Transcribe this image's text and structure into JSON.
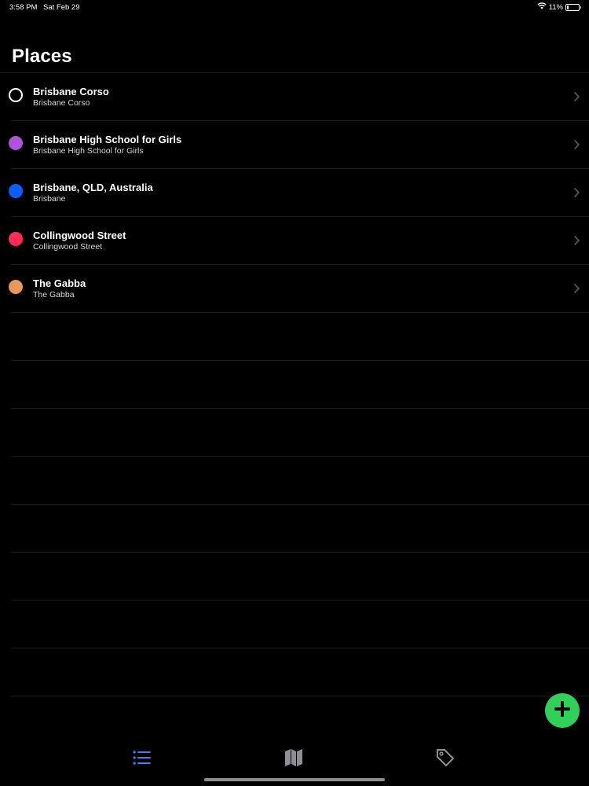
{
  "status_bar": {
    "time": "3:58 PM",
    "date": "Sat Feb 29",
    "battery_percent_label": "11%",
    "battery_level": 0.11,
    "icons": [
      "wifi-icon",
      "battery-icon"
    ]
  },
  "page": {
    "title": "Places"
  },
  "places": [
    {
      "title": "Brisbane Corso",
      "subtitle": "Brisbane Corso",
      "color": "#ffffff",
      "marker": "hollow"
    },
    {
      "title": "Brisbane High School for Girls",
      "subtitle": "Brisbane High School for Girls",
      "color": "#af52de",
      "marker": "filled"
    },
    {
      "title": "Brisbane, QLD, Australia",
      "subtitle": "Brisbane",
      "color": "#0a60ff",
      "marker": "filled"
    },
    {
      "title": "Collingwood Street",
      "subtitle": "Collingwood Street",
      "color": "#ff2d55",
      "marker": "filled"
    },
    {
      "title": "The Gabba",
      "subtitle": "The Gabba",
      "color": "#e8965a",
      "marker": "filled"
    }
  ],
  "empty_row_count": 8,
  "fab": {
    "icon": "plus-icon",
    "color": "#30d158"
  },
  "tab_bar": {
    "tabs": [
      {
        "name": "list",
        "icon": "list-icon",
        "selected": true
      },
      {
        "name": "map",
        "icon": "map-icon",
        "selected": false
      },
      {
        "name": "tags",
        "icon": "tag-icon",
        "selected": false
      }
    ],
    "selected_color": "#3a82f7",
    "unselected_color": "#8e8e93"
  }
}
